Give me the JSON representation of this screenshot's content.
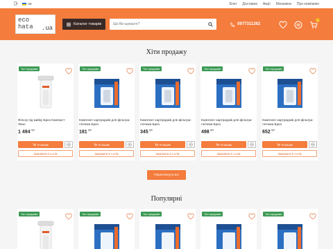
{
  "topbar": {
    "links": [
      "Блог",
      "Доставка",
      "Акції",
      "Магазини",
      "Про компанію"
    ],
    "lang": "ua"
  },
  "header": {
    "logo_top": "eco",
    "logo_bottom": "hata",
    "logo_domain": ".ua",
    "catalog_label": "Каталог товарів",
    "search_placeholder": "Що Ви шукаєте?",
    "phone": "0977311262",
    "cart_count": "0",
    "accent": "#f47c3c"
  },
  "sections": {
    "hits_title": "Хіти продажу",
    "popular_title": "Популярні",
    "more_label": "Переглянути всі"
  },
  "labels": {
    "badge": "Топ продажів",
    "in_cart": "В кошик",
    "quick_order": "Замовити в 1 клік",
    "currency": "грн"
  },
  "products": [
    {
      "name": "Фільтр під мийку Бриз Компакт+ Люкс",
      "price": "1 494",
      "kind": "housing"
    },
    {
      "name": "Комплект картриджів для фільтра-глечика Бриз",
      "price": "181",
      "kind": "box"
    },
    {
      "name": "Комплект картриджів для фільтра-глечика Бриз",
      "price": "345",
      "kind": "box"
    },
    {
      "name": "Комплект картриджів для фільтра-глечика Бриз",
      "price": "498",
      "kind": "box"
    },
    {
      "name": "Комплект картриджів для фільтра-глечика Бриз",
      "price": "652",
      "kind": "box"
    }
  ],
  "popular_products": [
    {
      "kind": "housing"
    },
    {
      "kind": "box"
    },
    {
      "kind": "box"
    },
    {
      "kind": "box"
    },
    {
      "kind": "box"
    }
  ]
}
